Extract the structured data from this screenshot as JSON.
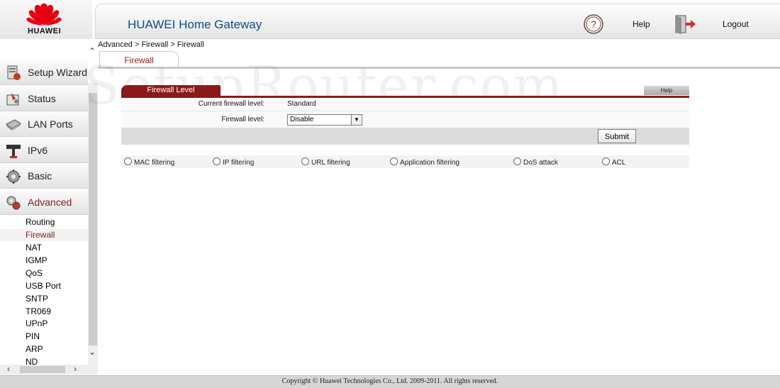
{
  "brand": {
    "name": "HUAWEI"
  },
  "header": {
    "title": "HUAWEI Home Gateway",
    "help_label": "Help",
    "logout_label": "Logout"
  },
  "sidebar": {
    "items": [
      {
        "label": "Setup Wizard",
        "icon": "wizard-icon"
      },
      {
        "label": "Status",
        "icon": "status-icon"
      },
      {
        "label": "LAN Ports",
        "icon": "lan-ports-icon"
      },
      {
        "label": "IPv6",
        "icon": "ipv6-icon"
      },
      {
        "label": "Basic",
        "icon": "basic-icon"
      },
      {
        "label": "Advanced",
        "icon": "advanced-icon",
        "active": true
      }
    ],
    "subitems": [
      "Routing",
      "Firewall",
      "NAT",
      "IGMP",
      "QoS",
      "USB Port",
      "SNTP",
      "TR069",
      "UPnP",
      "PIN",
      "ARP",
      "ND"
    ],
    "active_subitem": "Firewall"
  },
  "breadcrumb": "Advanced > Firewall > Firewall",
  "tab": {
    "label": "Firewall"
  },
  "watermark": "SetupRouter.com",
  "section": {
    "title": "Firewall Level",
    "help_label": "Help"
  },
  "form": {
    "current_label": "Current firewall level:",
    "current_value": "Standard",
    "level_label": "Firewall level:",
    "level_value": "Disable",
    "submit_label": "Submit"
  },
  "filters": [
    "MAC filtering",
    "IP filtering",
    "URL filtering",
    "Application filtering",
    "DoS attack",
    "ACL"
  ],
  "footer": {
    "copyright": "Copyright © Huawei Technologies Co., Ltd. 2009-2011. All rights reserved."
  },
  "colors": {
    "accent": "#8a1a1a",
    "title_blue": "#0b4d8a"
  }
}
